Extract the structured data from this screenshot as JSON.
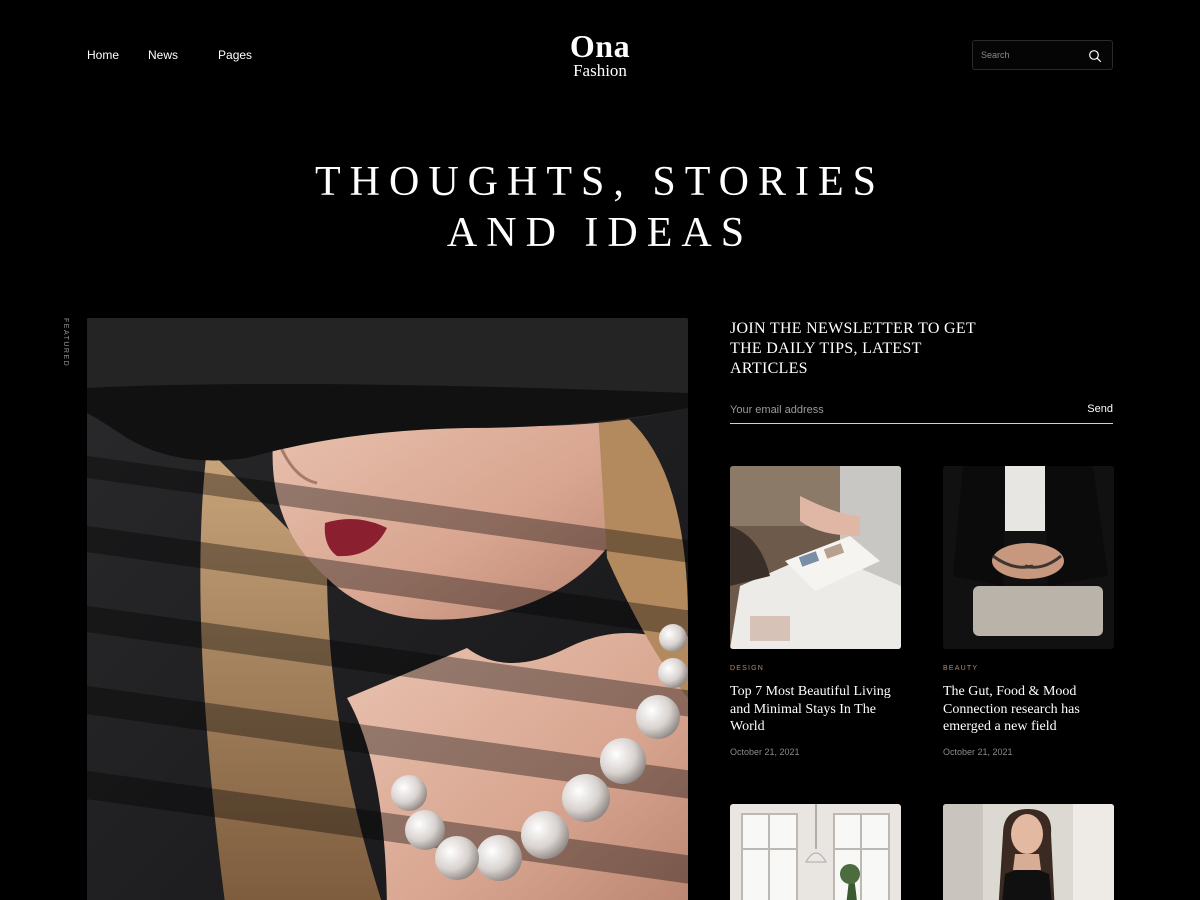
{
  "nav": {
    "home": "Home",
    "news": "News",
    "pages": "Pages"
  },
  "logo": {
    "line1": "Ona",
    "line2": "Fashion"
  },
  "search": {
    "placeholder": "Search",
    "icon": "search-icon"
  },
  "hero": {
    "line1": "THOUGHTS, STORIES",
    "line2": "AND IDEAS"
  },
  "featured": {
    "label": "FEATURED"
  },
  "newsletter": {
    "title_lines": [
      "JOIN THE NEWSLETTER TO GET",
      "THE DAILY TIPS, LATEST",
      "ARTICLES"
    ],
    "email_placeholder": "Your email address",
    "send_label": "Send"
  },
  "articles": [
    {
      "category": "DESIGN",
      "title": "Top 7 Most Beautiful Living and Minimal Stays In The World",
      "date": "October 21, 2021"
    },
    {
      "category": "BEAUTY",
      "title": "The Gut, Food & Mood Connection research has emerged a new field",
      "date": "October 21, 2021"
    }
  ],
  "colors": {
    "background": "#000000",
    "accent_category": "#b48a6a",
    "text": "#ffffff",
    "muted": "#8a8a8a"
  }
}
